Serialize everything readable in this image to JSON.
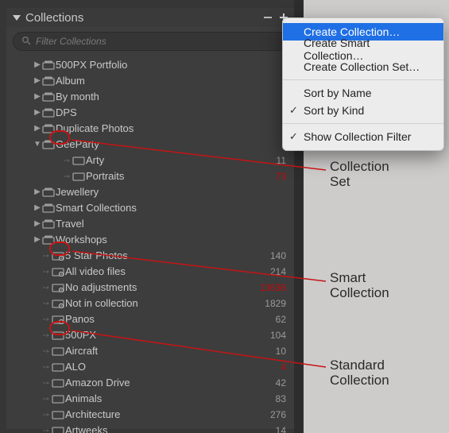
{
  "header": {
    "title": "Collections"
  },
  "filter": {
    "placeholder": "Filter Collections"
  },
  "tree": {
    "items": [
      {
        "label": "500PX Portfolio",
        "kind": "set",
        "indent": 1,
        "arrow": "right",
        "count": ""
      },
      {
        "label": "Album",
        "kind": "set",
        "indent": 1,
        "arrow": "right",
        "count": ""
      },
      {
        "label": "By month",
        "kind": "set",
        "indent": 1,
        "arrow": "right",
        "count": ""
      },
      {
        "label": "DPS",
        "kind": "set",
        "indent": 1,
        "arrow": "right",
        "count": ""
      },
      {
        "label": "Duplicate Photos",
        "kind": "set",
        "indent": 1,
        "arrow": "right",
        "count": ""
      },
      {
        "label": "GeeParty",
        "kind": "set",
        "indent": 1,
        "arrow": "down",
        "count": ""
      },
      {
        "label": "Arty",
        "kind": "coll",
        "indent": 2,
        "arrow": "",
        "count": "11"
      },
      {
        "label": "Portraits",
        "kind": "coll",
        "indent": 2,
        "arrow": "",
        "count": "73",
        "hl": true
      },
      {
        "label": "Jewellery",
        "kind": "set",
        "indent": 1,
        "arrow": "right",
        "count": ""
      },
      {
        "label": "Smart Collections",
        "kind": "set",
        "indent": 1,
        "arrow": "right",
        "count": ""
      },
      {
        "label": "Travel",
        "kind": "set",
        "indent": 1,
        "arrow": "right",
        "count": ""
      },
      {
        "label": "Workshops",
        "kind": "set",
        "indent": 1,
        "arrow": "right",
        "count": ""
      },
      {
        "label": "5 Star Photos",
        "kind": "smart",
        "indent": 1,
        "arrow": "",
        "count": "140"
      },
      {
        "label": "All video files",
        "kind": "smart",
        "indent": 1,
        "arrow": "",
        "count": "214"
      },
      {
        "label": "No adjustments",
        "kind": "smart",
        "indent": 1,
        "arrow": "",
        "count": "13636",
        "hl": true
      },
      {
        "label": "Not in collection",
        "kind": "smart",
        "indent": 1,
        "arrow": "",
        "count": "1829"
      },
      {
        "label": "Panos",
        "kind": "smart",
        "indent": 1,
        "arrow": "",
        "count": "62"
      },
      {
        "label": "500PX",
        "kind": "coll",
        "indent": 1,
        "arrow": "",
        "count": "104"
      },
      {
        "label": "Aircraft",
        "kind": "coll",
        "indent": 1,
        "arrow": "",
        "count": "10"
      },
      {
        "label": "ALO",
        "kind": "coll",
        "indent": 1,
        "arrow": "",
        "count": "4",
        "hl": true
      },
      {
        "label": "Amazon Drive",
        "kind": "coll",
        "indent": 1,
        "arrow": "",
        "count": "42"
      },
      {
        "label": "Animals",
        "kind": "coll",
        "indent": 1,
        "arrow": "",
        "count": "83"
      },
      {
        "label": "Architecture",
        "kind": "coll",
        "indent": 1,
        "arrow": "",
        "count": "276"
      },
      {
        "label": "Artweeks",
        "kind": "coll",
        "indent": 1,
        "arrow": "",
        "count": "14"
      }
    ]
  },
  "menu": {
    "items": [
      {
        "label": "Create Collection…",
        "checked": false,
        "selected": true,
        "sep": false
      },
      {
        "label": "Create Smart Collection…",
        "checked": false,
        "selected": false,
        "sep": false
      },
      {
        "label": "Create Collection Set…",
        "checked": false,
        "selected": false,
        "sep": false
      },
      {
        "sep": true
      },
      {
        "label": "Sort by Name",
        "checked": false,
        "selected": false,
        "sep": false
      },
      {
        "label": "Sort by Kind",
        "checked": true,
        "selected": false,
        "sep": false
      },
      {
        "sep": true
      },
      {
        "label": "Show Collection Filter",
        "checked": true,
        "selected": false,
        "sep": false
      }
    ]
  },
  "annotations": {
    "a1_line1": "Collection",
    "a1_line2": "Set",
    "a2_line1": "Smart",
    "a2_line2": "Collection",
    "a3_line1": "Standard",
    "a3_line2": "Collection"
  }
}
